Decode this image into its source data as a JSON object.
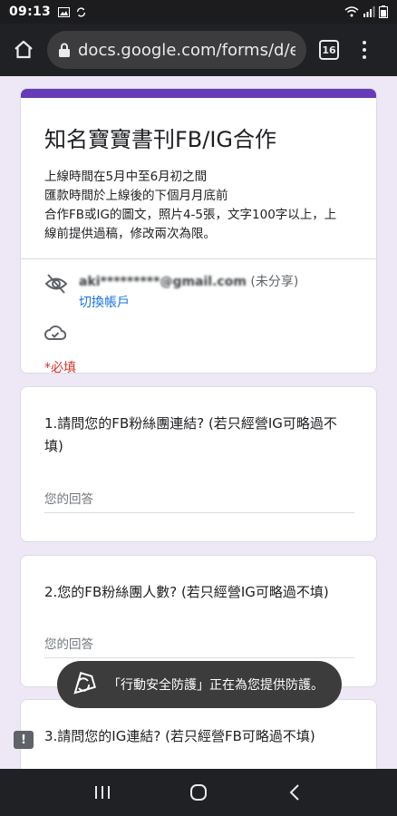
{
  "status_bar": {
    "time": "09:13",
    "icons_left": [
      "image-icon",
      "shield-refresh-icon"
    ],
    "icons_right": [
      "wifi-icon",
      "signal-icon",
      "battery-icon"
    ]
  },
  "browser": {
    "url": "docs.google.com/forms/d/e",
    "tab_count": "16"
  },
  "form": {
    "title": "知名寶寶書刊FB/IG合作",
    "description": [
      "上線時間在5月中至6月初之間",
      "匯款時間於上線後的下個月月底前",
      "合作FB或IG的圖文，照片4-5張，文字100字以上，上",
      "線前提供過稿，修改兩次為限。"
    ],
    "account_email": "aki*********@gmail.com",
    "account_note": "(未分享)",
    "switch_account": "切換帳戶",
    "required_note": "*必填"
  },
  "questions": [
    {
      "title": "1.請問您的FB粉絲團連結? (若只經營IG可略過不填)",
      "placeholder": "您的回答"
    },
    {
      "title": "2.您的FB粉絲團人數? (若只經營IG可略過不填)",
      "placeholder": "您的回答"
    },
    {
      "title": "3.請問您的IG連結? (若只經營FB可略過不填)",
      "placeholder": ""
    }
  ],
  "toast": {
    "text": "「行動安全防護」正在為您提供防護。"
  },
  "colors": {
    "accent": "#673ab7",
    "background": "#ede7f6",
    "required": "#d93025",
    "link": "#1a73e8"
  }
}
